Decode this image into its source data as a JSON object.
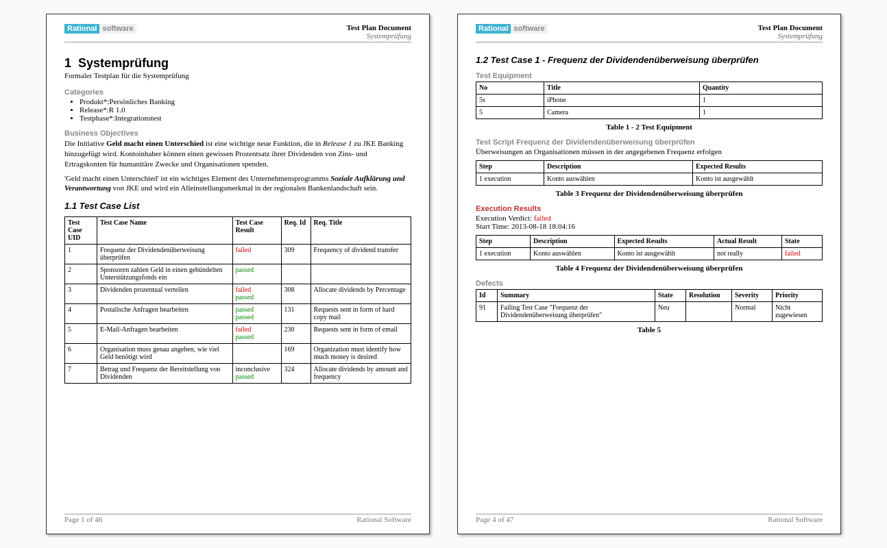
{
  "header": {
    "logo_badge": "Rational",
    "logo_text": "software",
    "doc_title": "Test Plan Document",
    "doc_sub": "Systemprüfung"
  },
  "page1": {
    "section_no": "1",
    "section_title": "Systemprüfung",
    "subtitle": "Formaler Testplan für die Systemprüfung",
    "cat_label": "Categories",
    "cats": [
      "Produkt*:Persönliches Banking",
      "Release*:R 1.0",
      "Testphase*:Integrationstest"
    ],
    "biz_label": "Business Objectives",
    "biz_p1a": "Die Initiative ",
    "biz_p1b": "Geld macht einen Unterschied",
    "biz_p1c": " ist eine wichtige neue Funktion, die in ",
    "biz_p1d": "Release 1",
    "biz_p1e": " zu JKE Banking hinzugefügt wird. Kontoinhaber können einen gewissen Prozentsatz ihrer Dividenden von Zins- und Ertragskonten für humanitäre Zwecke und Organisationen spenden.",
    "biz_p2a": "'Geld macht einen Unterschied' ist ein wichtiges Element des Unternehmensprogramms ",
    "biz_p2b": "Soziale Aufklärung und Verantwortung",
    "biz_p2c": " von JKE und wird ein Alleinstellungsmerkmal in der regionalen Bankenlandschaft sein.",
    "tclist_heading": "1.1  Test Case List",
    "tc_headers": [
      "Test Case UID",
      "Test Case Name",
      "Test Case Result",
      "Req. Id",
      "Req. Title"
    ],
    "tc_rows": [
      {
        "uid": "1",
        "name": "Frequenz der Dividendenüberweisung überprüfen",
        "results": [
          "failed"
        ],
        "req": "309",
        "title": "Frequency of dividend transfer"
      },
      {
        "uid": "2",
        "name": "Sponsoren zahlen Geld in einen gebündelten Unterstützungsfonds ein",
        "results": [
          "passed"
        ],
        "req": "",
        "title": ""
      },
      {
        "uid": "3",
        "name": "Dividenden prozentual verteilen",
        "results": [
          "failed",
          "passed"
        ],
        "req": "308",
        "title": "Allocate dividends by Percentage"
      },
      {
        "uid": "4",
        "name": "Postalische Anfragen bearbeiten",
        "results": [
          "passed",
          "passed"
        ],
        "req": "131",
        "title": "Requests sent in form of hard copy mail"
      },
      {
        "uid": "5",
        "name": "E-Mail-Anfragen bearbeiten",
        "results": [
          "failed",
          "passed"
        ],
        "req": "230",
        "title": "Requests sent in form of email"
      },
      {
        "uid": "6",
        "name": "Organisation muss genau angeben, wie viel Geld benötigt wird",
        "results": [],
        "req": "169",
        "title": "Organization must identify how much money is desired"
      },
      {
        "uid": "7",
        "name": "Betrag und Frequenz der Bereitstellung von Dividenden",
        "results": [
          "inconclusive",
          "passed"
        ],
        "req": "324",
        "title": "Allocate dividends by amount and frequency"
      }
    ],
    "footer_left": "Page 1 of  46",
    "footer_right": "Rational Software"
  },
  "page2": {
    "section_heading": "1.2  Test Case 1 - Frequenz der Dividendenüberweisung überprüfen",
    "equip_label": "Test Equipment",
    "equip_headers": [
      "No",
      "Title",
      "Quantity"
    ],
    "equip_rows": [
      {
        "no": "5s",
        "title": "iPhone",
        "qty": "1"
      },
      {
        "no": "5",
        "title": "Camera",
        "qty": "1"
      }
    ],
    "equip_caption": "Table 1 - 2 Test Equipment",
    "ts_label": "Test Script Frequenz der Dividendenüberweisung überprüfen",
    "ts_desc": "Überweisungen an Organisationen müssen in der angegebenen Frequenz erfolgen",
    "ts_headers": [
      "Step",
      "Description",
      "Expected Results"
    ],
    "ts_rows": [
      {
        "step": "1 execution",
        "desc": "Konto auswählen",
        "exp": "Konto ist ausgewählt"
      }
    ],
    "ts_caption": "Table 3 Frequenz der Dividendenüberweisung überprüfen",
    "exec_label": "Execution Results",
    "exec_verdict_label": "Execution Verdict: ",
    "exec_verdict": "failed",
    "exec_start": "Start Time: 2013-08-18 18:04:16",
    "er_headers": [
      "Step",
      "Description",
      "Expected Results",
      "Actual Result",
      "State"
    ],
    "er_rows": [
      {
        "step": "1 execution",
        "desc": "Konto auswählen",
        "exp": "Konto ist ausgewählt",
        "act": "not really",
        "state": "failed"
      }
    ],
    "er_caption": "Table 4 Frequenz der Dividendenüberweisung überprüfen",
    "def_label": "Defects",
    "def_headers": [
      "Id",
      "Summary",
      "State",
      "Resolution",
      "Severity",
      "Priority"
    ],
    "def_rows": [
      {
        "id": "91",
        "summary": "Failing Test Case \"Frequenz der Dividendenüberweisung überprüfen\"",
        "state": "Neu",
        "res": "",
        "sev": "Normal",
        "prio": "Nicht zugewiesen"
      }
    ],
    "def_caption": "Table 5",
    "footer_left": "Page 4 of  47",
    "footer_right": "Rational Software"
  }
}
